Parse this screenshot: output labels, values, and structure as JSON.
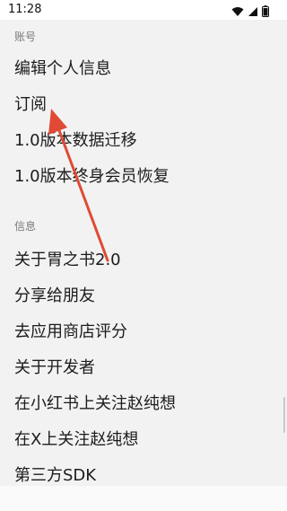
{
  "status_bar": {
    "time": "11:28",
    "icons": [
      "wifi-icon",
      "cellular-signal-icon",
      "battery-icon"
    ]
  },
  "sections": [
    {
      "header": "账号",
      "items": [
        {
          "label": "编辑个人信息"
        },
        {
          "label": "订阅"
        },
        {
          "label": "1.0版本数据迁移"
        },
        {
          "label": "1.0版本终身会员恢复"
        }
      ]
    },
    {
      "header": "信息",
      "items": [
        {
          "label": "关于胃之书2.0"
        },
        {
          "label": "分享给朋友"
        },
        {
          "label": "去应用商店评分"
        },
        {
          "label": "关于开发者"
        },
        {
          "label": "在小红书上关注赵纯想"
        },
        {
          "label": "在X上关注赵纯想"
        },
        {
          "label": "第三方SDK"
        }
      ]
    }
  ],
  "colors": {
    "background": "#f2f2f2",
    "section_header": "#7a7a7a",
    "item_text": "#1c1c1c",
    "annotation_arrow": "#e04a35"
  }
}
